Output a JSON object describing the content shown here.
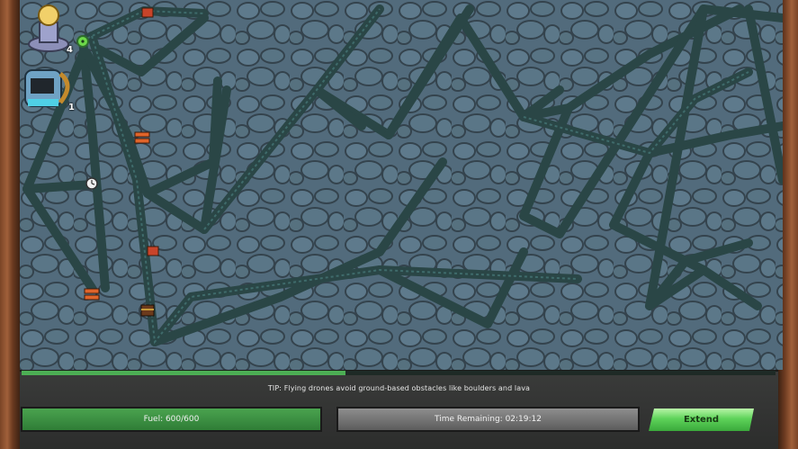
{
  "hud": {
    "drone_count": "4",
    "robot_count": "1"
  },
  "progress_fraction": 0.43,
  "tip": "TIP: Flying drones avoid ground-based obstacles like boulders and lava",
  "fuel_label": "Fuel: 600/600",
  "time_label": "Time Remaining: 02:19:12",
  "extend_label": "Extend",
  "colors": {
    "tunnel": "#2f4f4f",
    "rock": "#51697a",
    "fuel_green": "#3f9645",
    "extend_green": "#5ed35a"
  },
  "icons": [
    "drone-station-icon",
    "robot-icon",
    "radiation-icon",
    "clock-icon",
    "dynamite-icon",
    "treasure-chest-icon",
    "ore-crate-icon"
  ]
}
